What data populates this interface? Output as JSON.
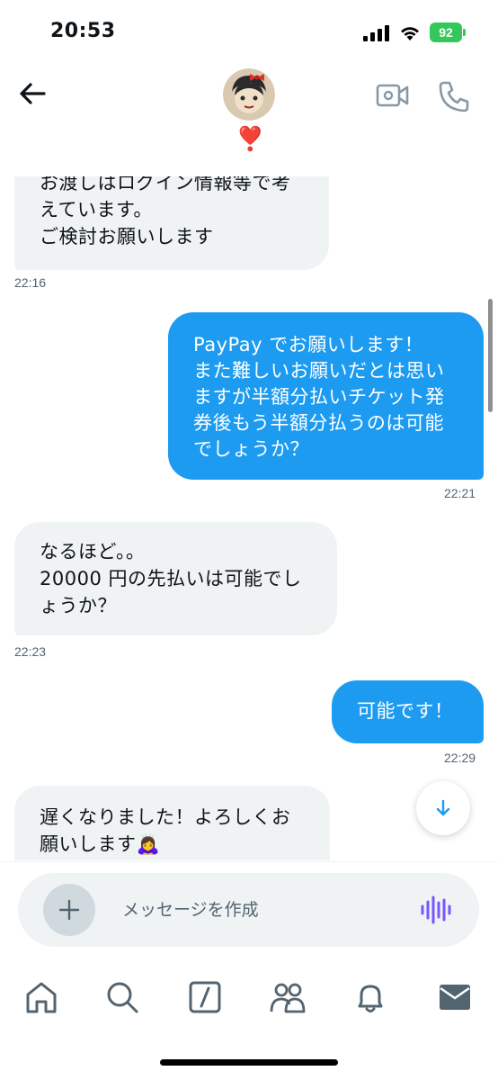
{
  "status_bar": {
    "time": "20:53",
    "battery": "92"
  },
  "header": {
    "avatar": "avatar-icon",
    "badge": "❣️",
    "icons": [
      "back-arrow-icon",
      "video-call-icon",
      "phone-call-icon"
    ]
  },
  "messages": [
    {
      "direction": "incoming",
      "text": "お渡しはログイン情報等で考\nえています。\nご検討お願いします",
      "time": "22:16"
    },
    {
      "direction": "outgoing",
      "text": "PayPay でお願いします！\nまた難しいお願いだとは思い\nますが半額分払いチケット発\n券後もう半額分払うのは可能\nでしょうか？",
      "time": "22:21"
    },
    {
      "direction": "incoming",
      "text": "なるほど。。\n20000 円の先払いは可能でし\nょうか？",
      "time": "22:23"
    },
    {
      "direction": "outgoing",
      "text": "可能です！",
      "time": "22:29"
    },
    {
      "direction": "incoming",
      "text": "遅くなりました！よろしくお\n願いします🙇‍♀️",
      "time": ""
    }
  ],
  "composer": {
    "placeholder": "メッセージを作成",
    "icons": [
      "add-icon",
      "voice-message-icon"
    ]
  },
  "nav": {
    "items": [
      "home-icon",
      "search-icon",
      "grok-icon",
      "communities-icon",
      "notifications-icon",
      "messages-icon"
    ]
  },
  "colors": {
    "outgoing_bubble": "#1d9bf0",
    "incoming_bubble": "#eff3f4",
    "battery": "#34c759",
    "voice_accent": "#7856ff"
  }
}
